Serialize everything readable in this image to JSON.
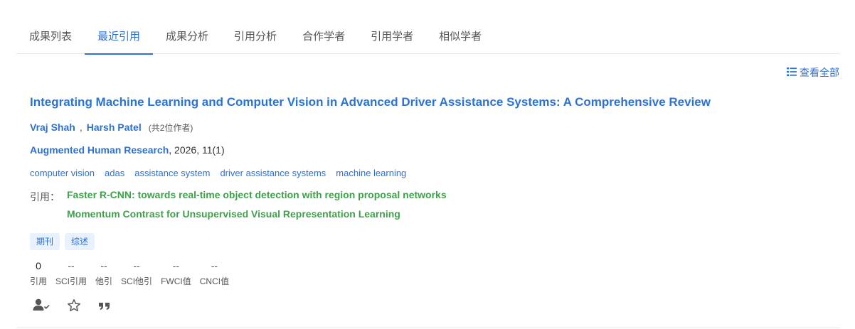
{
  "tabs": [
    {
      "label": "成果列表"
    },
    {
      "label": "最近引用",
      "active": true
    },
    {
      "label": "成果分析"
    },
    {
      "label": "引用分析"
    },
    {
      "label": "合作学者"
    },
    {
      "label": "引用学者"
    },
    {
      "label": "相似学者"
    }
  ],
  "view_all": {
    "label": "查看全部",
    "icon": "list-icon"
  },
  "paper": {
    "title": "Integrating Machine Learning and Computer Vision in Advanced Driver Assistance Systems: A Comprehensive Review",
    "authors": [
      "Vraj Shah",
      "Harsh Patel"
    ],
    "author_separator": ",",
    "author_count": "(共2位作者)",
    "venue": "Augmented Human Research",
    "venue_info": ", 2026, 11(1)",
    "keywords": [
      "computer vision",
      "adas",
      "assistance system",
      "driver assistance systems",
      "machine learning"
    ],
    "cite_label": "引用：",
    "citations": [
      "Faster R-CNN: towards real-time object detection with region proposal networks",
      "Momentum Contrast for Unsupervised Visual Representation Learning"
    ],
    "tags": [
      "期刊",
      "综述"
    ],
    "stats": [
      {
        "value": "0",
        "label": "引用"
      },
      {
        "value": "--",
        "label": "SCI引用"
      },
      {
        "value": "--",
        "label": "他引"
      },
      {
        "value": "--",
        "label": "SCI他引"
      },
      {
        "value": "--",
        "label": "FWCI值"
      },
      {
        "value": "--",
        "label": "CNCI值"
      }
    ],
    "actions": [
      "claim-author-icon",
      "star-icon",
      "quote-icon"
    ]
  },
  "colors": {
    "accent": "#2a72d4",
    "citation": "#3ea14a",
    "tag_bg": "#e8f1fc",
    "divider": "#e4e7ed"
  }
}
